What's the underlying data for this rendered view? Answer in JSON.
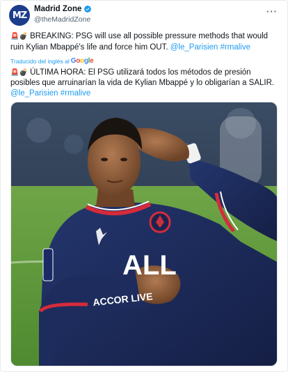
{
  "account": {
    "display_name": "Madrid Zone",
    "handle": "@theMadridZone",
    "avatar_text": "MZ",
    "verified_color": "#1d9bf0",
    "more_label": "···"
  },
  "tweet": {
    "en_line1": "BREAKING: PSG will use all possible pressure methods that would",
    "en_line2": "ruin Kylian Mbappé's life and force him OUT.",
    "en_mention": "@le_Parisien",
    "en_hashtag": "#rmalive",
    "translated_label": "Traducido del inglés al",
    "translated_brand": "Google",
    "es_line1": "ÚLTIMA HORA: El PSG utilizará todos los métodos de presión",
    "es_line2": "posibles que arruinarían la vida de Kylian Mbappé y lo obligarían a SALIR.",
    "es_mention": "@le_Parisien",
    "es_hashtag": "#rmalive"
  },
  "image": {
    "jersey_sponsor": "ALL",
    "jersey_text": "ACCOR LIVE"
  },
  "colors": {
    "link": "#1d9bf0",
    "avatar_bg": "#1d3c8c",
    "jersey_navy": "#1c2a5e",
    "pitch_green": "#5e9a3c"
  }
}
